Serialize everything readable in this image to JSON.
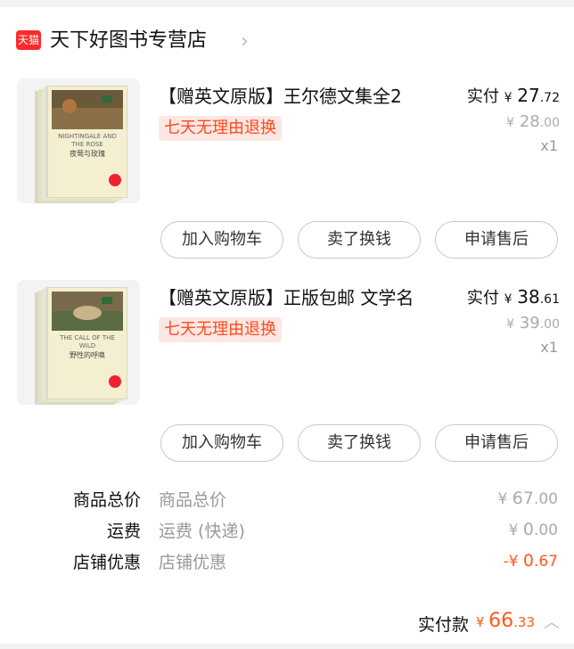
{
  "shop": {
    "logo_text": "天猫",
    "name": "天下好图书专营店",
    "chevron": "›"
  },
  "items": [
    {
      "title": "【赠英文原版】王尔德文集全2",
      "badge": "七天无理由退换",
      "paid_label": "实付",
      "paid_currency": "¥",
      "paid_int": "27",
      "paid_dec": ".72",
      "orig_currency": "¥",
      "orig_int": "28",
      "orig_dec": ".00",
      "qty": "x1",
      "cover_title": "NIGHTINGALE AND THE ROSE",
      "cover_cn": "夜莺与玫瑰",
      "buttons": [
        "加入购物车",
        "卖了换钱",
        "申请售后"
      ]
    },
    {
      "title": "【赠英文原版】正版包邮 文学名",
      "badge": "七天无理由退换",
      "paid_label": "实付",
      "paid_currency": "¥",
      "paid_int": "38",
      "paid_dec": ".61",
      "orig_currency": "¥",
      "orig_int": "39",
      "orig_dec": ".00",
      "qty": "x1",
      "cover_title": "THE CALL OF THE WILD",
      "cover_cn": "野性的呼唤",
      "buttons": [
        "加入购物车",
        "卖了换钱",
        "申请售后"
      ]
    }
  ],
  "summary": [
    {
      "label": "商品总价",
      "value": "商品总价",
      "amount_currency": "¥",
      "amount_int": "67",
      "amount_dec": ".00"
    },
    {
      "label": "运费",
      "value": "运费 (快递)",
      "amount_currency": "¥",
      "amount_int": "0",
      "amount_dec": ".00"
    },
    {
      "label": "店铺优惠",
      "value": "店铺优惠",
      "amount_currency": "-¥",
      "amount_int": "0",
      "amount_dec": ".67"
    }
  ],
  "total": {
    "label": "实付款",
    "currency": "¥",
    "int": "66",
    "dec": ".33"
  },
  "colors": {
    "accent": "#ff5a1f",
    "tmall_red": "#ff2a2a",
    "badge_bg": "#fde7e2"
  }
}
